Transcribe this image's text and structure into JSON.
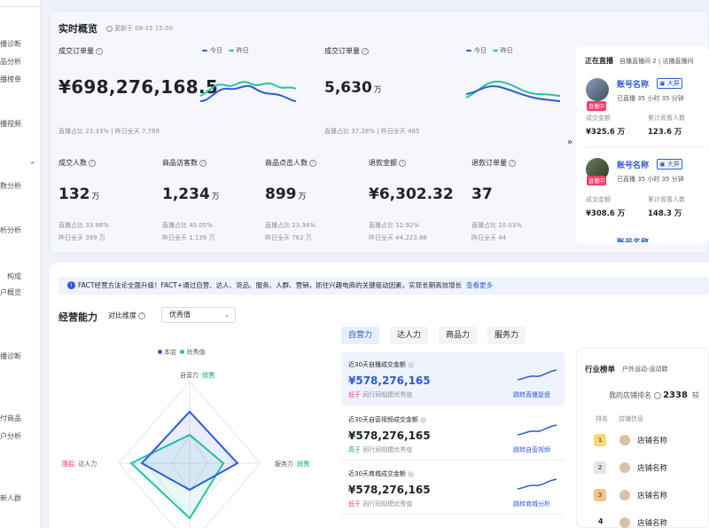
{
  "sidebar": {
    "items": [
      "播诊断",
      "品分析",
      "播榜单",
      "播视频",
      "数分析",
      "析分析",
      "构成",
      "户概览",
      "播诊断",
      "付商品",
      "户分析",
      "新人群"
    ]
  },
  "overview": {
    "title": "实时概览",
    "updated": "更新于 09-15 15:00",
    "legend_today": "今日",
    "legend_yesterday": "昨日",
    "gmv": {
      "label": "成交订单量",
      "value": "¥698,276,168.5",
      "live_ratio": "直播占比 23.33%",
      "yesterday": "昨日全天 7,789"
    },
    "orders": {
      "label": "成交订单量",
      "value": "5,630",
      "unit": "万",
      "live_ratio": "直播占比 37.28%",
      "yesterday": "昨日全天 485"
    },
    "metrics": [
      {
        "label": "成交人数",
        "value": "132",
        "unit": "万",
        "ratio": "直播占比 33.98%",
        "yesterday": "昨日全天 399 万"
      },
      {
        "label": "商品访客数",
        "value": "1,234",
        "unit": "万",
        "ratio": "直播占比 40.05%",
        "yesterday": "昨日全天 1,139 万"
      },
      {
        "label": "商品点击人数",
        "value": "899",
        "unit": "万",
        "ratio": "直播占比 23.34%",
        "yesterday": "昨日全天 762 万"
      },
      {
        "label": "退款金额",
        "value": "¥6,302.32",
        "unit": "",
        "ratio": "直播占比 12.92%",
        "yesterday": "昨日全天 ¥4,223.86"
      },
      {
        "label": "退款订单量",
        "value": "37",
        "unit": "",
        "ratio": "直播占比 10.03%",
        "yesterday": "昨日全天 44"
      }
    ]
  },
  "live": {
    "title": "正在直播",
    "subtitle": "自播直播间 2 | 达播直播间",
    "cards": [
      {
        "name": "账号名称",
        "tag": "直播中",
        "big": "大屏",
        "duration": "已直播 35 小时 35 分钟",
        "gmv_label": "成交金额",
        "gmv": "¥325.6 万",
        "viewers_label": "累计观看人数",
        "viewers": "123.6 万"
      },
      {
        "name": "账号名称",
        "tag": "直播中",
        "big": "大屏",
        "duration": "已直播 35 小时 35 分钟",
        "gmv_label": "成交金额",
        "gmv": "¥308.6 万",
        "viewers_label": "累计观看人数",
        "viewers": "148.3 万"
      }
    ],
    "third_name": "账号名称"
  },
  "banner": {
    "text": "FACT经营方法论全面升级！FACT+通过自营、达人、货品、服务、人群、营销，抓住兴趣电商的关键驱动因素，实现长期高效增长",
    "link": "查看更多"
  },
  "ability": {
    "title": "经营能力",
    "compare_label": "对比维度",
    "compare_value": "优秀值",
    "legend_store": "本店",
    "legend_excellent": "优秀值",
    "axis_top": "自营力",
    "axis_left": "达人力",
    "axis_right": "服务力",
    "badge_top": "优秀",
    "badge_left": "落后",
    "badge_right": "优秀"
  },
  "tabs": [
    "自营力",
    "达人力",
    "商品力",
    "服务力"
  ],
  "metric_cards": [
    {
      "title": "近30天自播成交金额",
      "value": "¥578,276,165",
      "note_tag": "低于",
      "note": "同行同规模优秀值",
      "link": "跳转直播复盘"
    },
    {
      "title": "近30天自营视频成交金额",
      "value": "¥578,276,165",
      "note_tag": "高于",
      "note": "同行同规模优秀值",
      "link": "跳转自营视频"
    },
    {
      "title": "近30天商城成交金额",
      "value": "¥578,276,165",
      "note_tag": "低于",
      "note": "同行同规模优秀值",
      "link": "跳转商城分析"
    }
  ],
  "ranking": {
    "title": "行业榜单",
    "category": "户外运动-运动鞋",
    "my_rank_label": "我的店铺排名",
    "my_rank": "2338",
    "extra": "较",
    "col_rank": "排名",
    "col_shop": "店铺信息",
    "rows": [
      {
        "rank": "1",
        "shop": "店铺名称"
      },
      {
        "rank": "2",
        "shop": "店铺名称"
      },
      {
        "rank": "3",
        "shop": "店铺名称"
      },
      {
        "rank": "4",
        "shop": "店铺名称"
      }
    ]
  },
  "colors": {
    "primary": "#2d5bd6",
    "teal": "#23c4a6",
    "red": "#ff3b6a"
  }
}
